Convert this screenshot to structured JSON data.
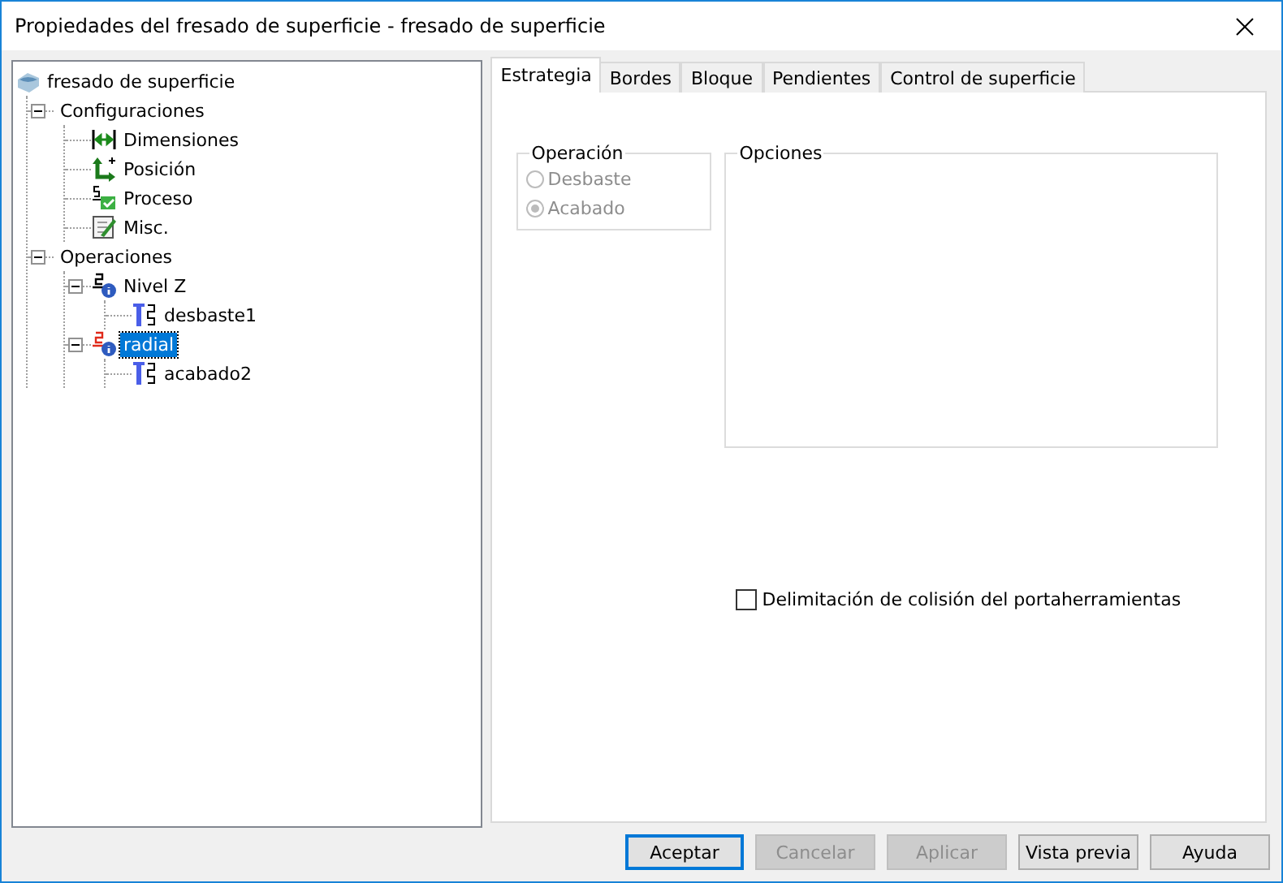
{
  "window": {
    "title": "Propiedades del fresado de superficie - fresado de superficie"
  },
  "tree": {
    "items": [
      {
        "label": "fresado de superficie",
        "kind": "part",
        "selected": false,
        "children": [
          {
            "label": "Configuraciones",
            "selected": false,
            "expanded": true,
            "children": [
              {
                "label": "Dimensiones",
                "kind": "dimension",
                "selected": false
              },
              {
                "label": "Posición",
                "kind": "position",
                "selected": false
              },
              {
                "label": "Proceso",
                "kind": "process",
                "selected": false
              },
              {
                "label": "Misc.",
                "kind": "misc",
                "selected": false
              }
            ]
          },
          {
            "label": "Operaciones",
            "selected": false,
            "expanded": true,
            "children": [
              {
                "label": "Nivel Z",
                "kind": "operation",
                "selected": false,
                "expanded": true,
                "children": [
                  {
                    "label": "desbaste1",
                    "kind": "tool",
                    "selected": false
                  }
                ]
              },
              {
                "label": "radial",
                "kind": "operation-current",
                "selected": true,
                "expanded": true,
                "children": [
                  {
                    "label": "acabado2",
                    "kind": "tool",
                    "selected": false
                  }
                ]
              }
            ]
          }
        ]
      }
    ]
  },
  "tabs": [
    {
      "label": "Estrategia",
      "selected": true
    },
    {
      "label": "Bordes",
      "selected": false
    },
    {
      "label": "Bloque",
      "selected": false
    },
    {
      "label": "Pendientes",
      "selected": false
    },
    {
      "label": "Control de superficie",
      "selected": false
    }
  ],
  "operation_group": {
    "title": "Operación",
    "options": [
      {
        "label": "Desbaste",
        "selected": false,
        "disabled": true
      },
      {
        "label": "Acabado",
        "selected": true,
        "disabled": true
      }
    ]
  },
  "options_group": {
    "title": "Opciones"
  },
  "holder_collision": {
    "label": "Delimitación de colisión del portaherramientas",
    "checked": false
  },
  "buttons": [
    {
      "label": "Aceptar",
      "default": true,
      "disabled": false
    },
    {
      "label": "Cancelar",
      "default": false,
      "disabled": true
    },
    {
      "label": "Aplicar",
      "default": false,
      "disabled": true
    },
    {
      "label": "Vista previa",
      "default": false,
      "disabled": false
    },
    {
      "label": "Ayuda",
      "default": false,
      "disabled": false
    }
  ]
}
